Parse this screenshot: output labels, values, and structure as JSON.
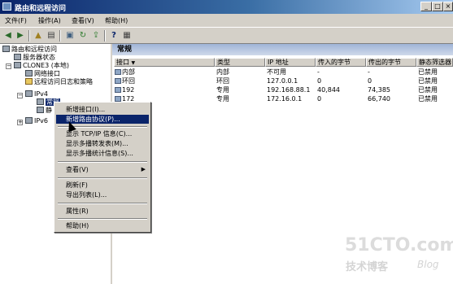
{
  "window": {
    "title": "路由和远程访问",
    "min": "_",
    "max": "□",
    "close": "×"
  },
  "menubar": {
    "items": [
      "文件(F)",
      "操作(A)",
      "查看(V)",
      "帮助(H)"
    ]
  },
  "toolbar": {
    "icons": [
      "back-icon",
      "forward-icon",
      "up-icon",
      "show-hide-tree-icon",
      "refresh-icon",
      "export-icon",
      "properties-icon",
      "help-icon",
      "console-icon"
    ]
  },
  "tree": {
    "root": "路由和远程访问",
    "server_status": "服务器状态",
    "server": "CLONE3 (本地)",
    "network_interfaces": "网络接口",
    "remote_logging": "远程访问日志和策略",
    "ipv4": "IPv4",
    "general": "常规",
    "static": "静",
    "ipv6": "IPv6"
  },
  "pane": {
    "title": "常规"
  },
  "table": {
    "columns": [
      "接口",
      "类型",
      "IP 地址",
      "传入的字节",
      "传出的字节",
      "静态筛选器"
    ],
    "rows": [
      [
        "内部",
        "内部",
        "不可用",
        "-",
        "-",
        "已禁用"
      ],
      [
        "环回",
        "环回",
        "127.0.0.1",
        "0",
        "0",
        "已禁用"
      ],
      [
        "192",
        "专用",
        "192.168.88.1",
        "40,844",
        "74,385",
        "已禁用"
      ],
      [
        "172",
        "专用",
        "172.16.0.1",
        "0",
        "66,740",
        "已禁用"
      ]
    ]
  },
  "context_menu": {
    "items": [
      "新增接口(I)...",
      "新增路由协议(P)...",
      "显示 TCP/IP 信息(C)...",
      "显示多播转发表(M)...",
      "显示多播统计信息(S)...",
      "查看(V)",
      "刷新(F)",
      "导出列表(L)...",
      "属性(R)",
      "帮助(H)"
    ],
    "highlighted": "新增路由协议(P)..."
  },
  "watermark": {
    "line1": "51CTO.com",
    "line2": "技术博客",
    "line3": "Blog"
  }
}
